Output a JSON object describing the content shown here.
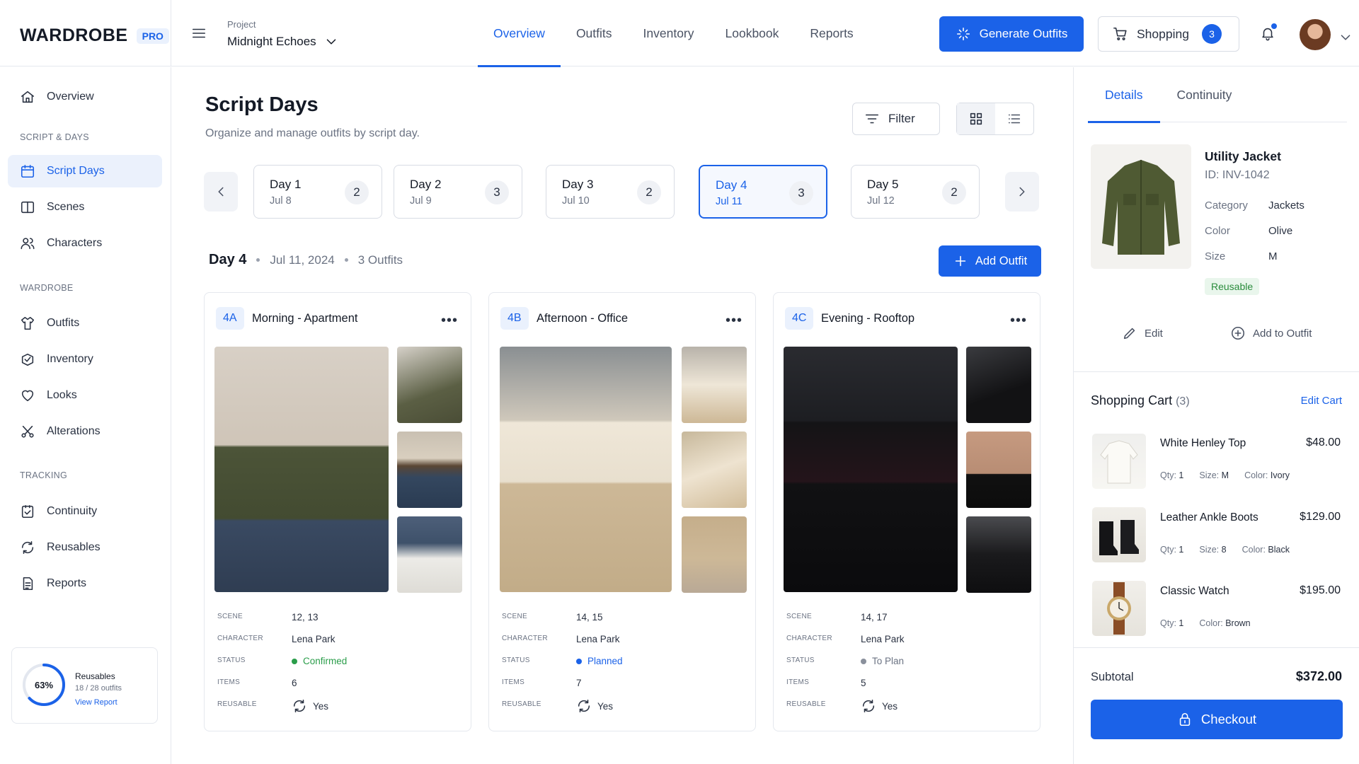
{
  "header": {
    "brand": "WARDROBE",
    "brand_badge": "PRO",
    "project_label": "Project",
    "project_name": "Midnight Echoes",
    "nav": [
      {
        "label": "Overview",
        "active": true
      },
      {
        "label": "Outfits"
      },
      {
        "label": "Inventory"
      },
      {
        "label": "Lookbook"
      },
      {
        "label": "Reports"
      }
    ],
    "generate_label": "Generate Outfits",
    "shopping_label": "Shopping",
    "shopping_count": "3",
    "accent_color": "#1b62e8"
  },
  "sidebar": {
    "items": [
      {
        "label": "Overview",
        "icon": "home-icon"
      },
      {
        "label": "Script Days",
        "icon": "calendar-icon",
        "active": true
      },
      {
        "label": "Scenes",
        "icon": "scenes-icon"
      },
      {
        "label": "Characters",
        "icon": "users-icon"
      },
      {
        "label": "Outfits",
        "icon": "outfits-icon"
      },
      {
        "label": "Inventory",
        "icon": "inventory-icon"
      },
      {
        "label": "Looks",
        "icon": "heart-icon"
      },
      {
        "label": "Alterations",
        "icon": "scissors-icon"
      },
      {
        "label": "Continuity",
        "icon": "continuity-icon"
      },
      {
        "label": "Reusables",
        "icon": "recycle-icon"
      },
      {
        "label": "Reports",
        "icon": "report-icon"
      }
    ],
    "sections": [
      "SCRIPT & DAYS",
      "WARDROBE",
      "TRACKING"
    ],
    "reusables_card": {
      "percent": "63%",
      "percent_value": 0.63,
      "title": "Reusables",
      "detail": "18 / 28 outfits",
      "link": "View Report"
    }
  },
  "main": {
    "title": "Script Days",
    "subtitle": "Organize and manage outfits by script day.",
    "filter_label": "Filter",
    "days": [
      {
        "name": "Day 1",
        "date": "Jul 8",
        "count": "2"
      },
      {
        "name": "Day 2",
        "date": "Jul 9",
        "count": "3"
      },
      {
        "name": "Day 3",
        "date": "Jul 10",
        "count": "2"
      },
      {
        "name": "Day 4",
        "date": "Jul 11",
        "count": "3",
        "active": true
      },
      {
        "name": "Day 5",
        "date": "Jul 12",
        "count": "2"
      }
    ],
    "summary": {
      "day": "Day 4",
      "date": "Jul 11, 2024",
      "outfits": "3 Outfits"
    },
    "add_outfit_label": "Add Outfit",
    "field_labels": {
      "scene": "SCENE",
      "character": "CHARACTER",
      "status": "STATUS",
      "items": "ITEMS",
      "reusable": "REUSABLE"
    },
    "outfits": [
      {
        "code": "4A",
        "title": "Morning - Apartment",
        "scene": "12, 13",
        "character": "Lena Park",
        "status": "Confirmed",
        "status_color": "#2a9d4a",
        "items": "6",
        "reusable": "Yes"
      },
      {
        "code": "4B",
        "title": "Afternoon - Office",
        "scene": "14, 15",
        "character": "Lena Park",
        "status": "Planned",
        "status_color": "#1b62e8",
        "items": "7",
        "reusable": "Yes"
      },
      {
        "code": "4C",
        "title": "Evening - Rooftop",
        "scene": "14, 17",
        "character": "Lena Park",
        "status": "To Plan",
        "status_color": "#8a909c",
        "items": "5",
        "reusable": "Yes"
      }
    ]
  },
  "details": {
    "tabs": [
      "Details",
      "Continuity"
    ],
    "item_name": "Utility Jacket",
    "item_id": "ID: INV-1042",
    "fields": [
      {
        "key": "Category",
        "value": "Jackets"
      },
      {
        "key": "Color",
        "value": "Olive"
      },
      {
        "key": "Size",
        "value": "M"
      }
    ],
    "badge": "Reusable",
    "edit_label": "Edit",
    "add_to_outfit_label": "Add to Outfit"
  },
  "cart": {
    "title": "Shopping Cart",
    "count": "(3)",
    "edit_label": "Edit Cart",
    "items": [
      {
        "name": "White Henley Top",
        "price": "$48.00",
        "qty_label": "Qty:",
        "qty": "1",
        "size_label": "Size:",
        "size": "M",
        "color_label": "Color:",
        "color": "Ivory"
      },
      {
        "name": "Leather Ankle Boots",
        "price": "$129.00",
        "qty_label": "Qty:",
        "qty": "1",
        "size_label": "Size:",
        "size": "8",
        "color_label": "Color:",
        "color": "Black"
      },
      {
        "name": "Classic Watch",
        "price": "$195.00",
        "qty_label": "Qty:",
        "qty": "1",
        "color_label": "Color:",
        "color": "Brown"
      }
    ],
    "subtotal_label": "Subtotal",
    "subtotal": "$372.00",
    "checkout_label": "Checkout"
  }
}
